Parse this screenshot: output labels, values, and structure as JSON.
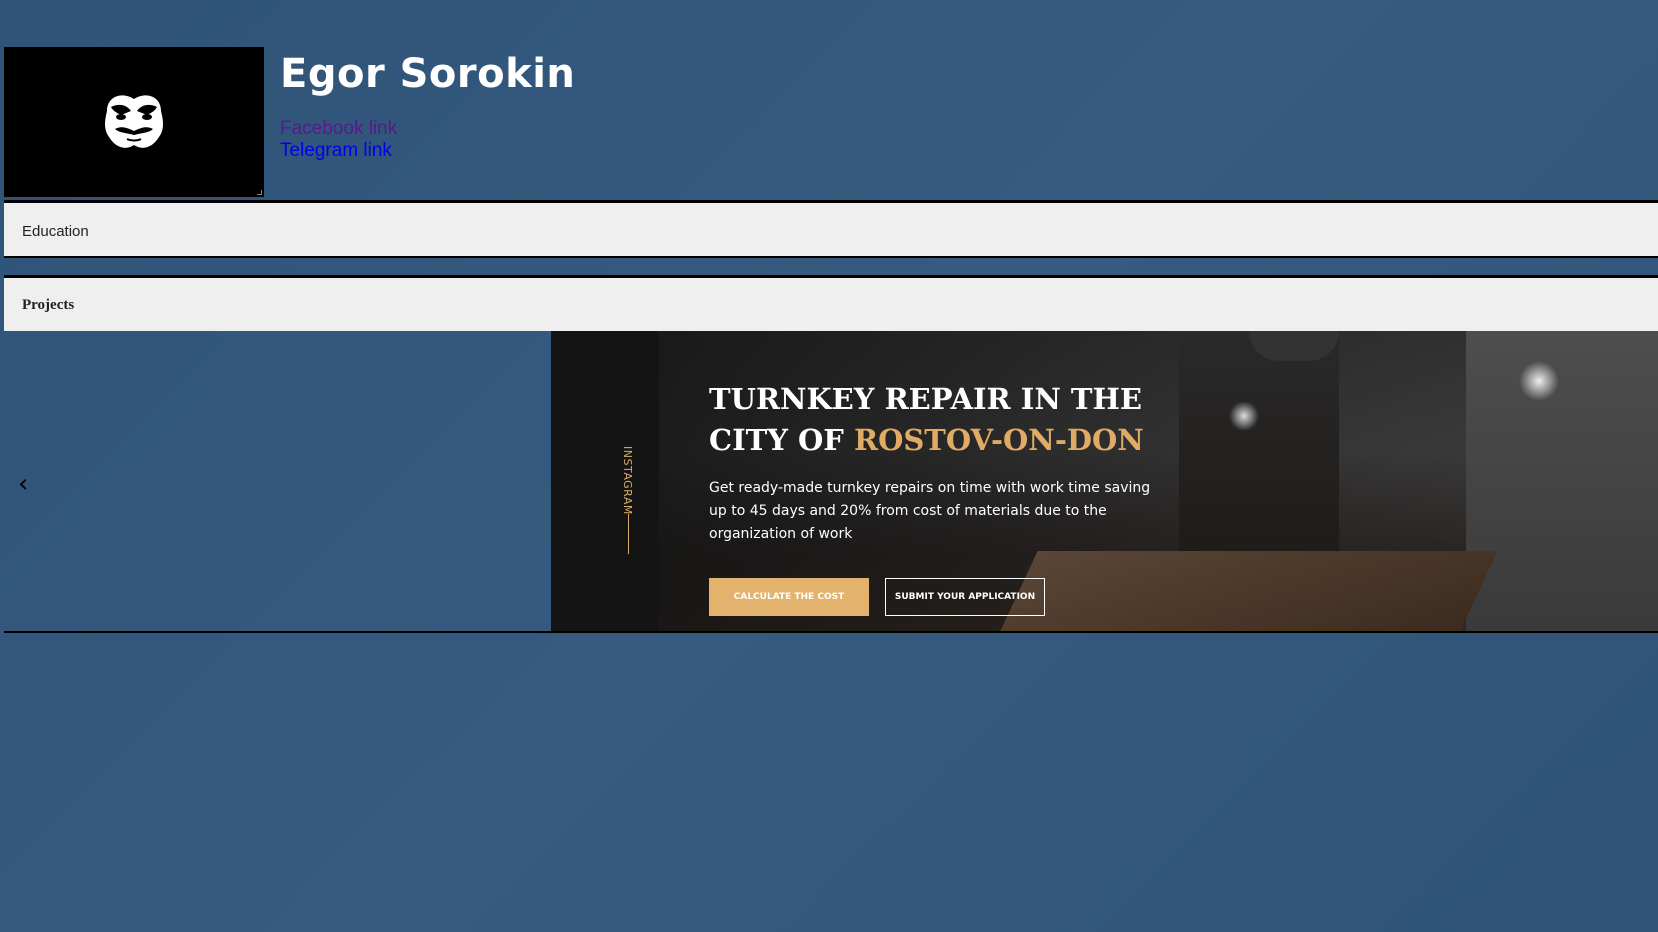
{
  "profile": {
    "name": "Egor Sorokin",
    "links": {
      "facebook": "Facebook link",
      "telegram": "Telegram link"
    }
  },
  "sections": {
    "education": "Education",
    "projects": "Projects"
  },
  "carousel": {
    "prev_arrow": "‹",
    "slide": {
      "sidebar_label": "INSTAGRAM",
      "title_line1": "TURNKEY REPAIR IN THE",
      "title_line2_prefix": "CITY OF ",
      "title_line2_accent": "ROSTOV-ON-DON",
      "description": "Get ready-made turnkey repairs on time with work time saving up to 45 days and 20% from cost of materials due to the organization of work",
      "button_calculate": "CALCULATE THE COST",
      "button_submit": "SUBMIT YOUR APPLICATION"
    }
  },
  "colors": {
    "background": "#33577c",
    "accent_gold": "#e3b36d",
    "section_bar": "#efefef"
  },
  "icons": {
    "avatar": "mask-icon",
    "carousel_prev": "chevron-left-icon"
  }
}
